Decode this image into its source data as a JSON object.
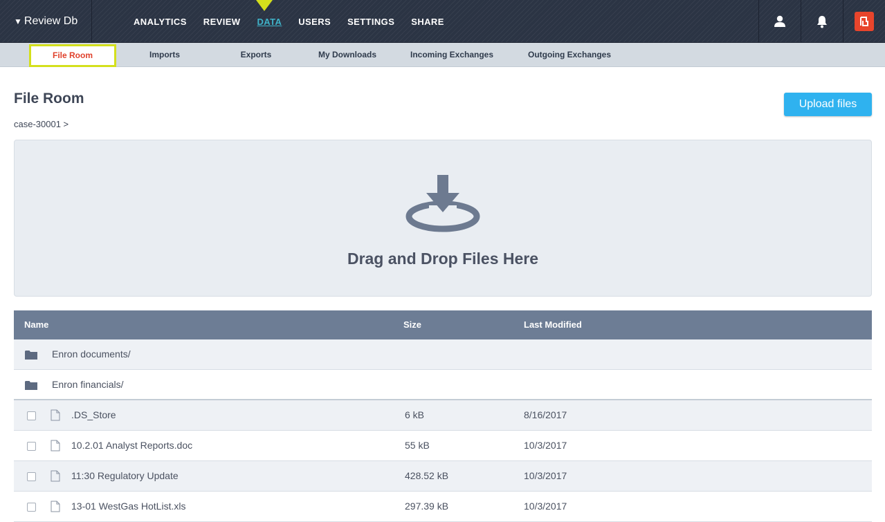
{
  "app": {
    "brand": "Review Db",
    "brand_caret": "▼"
  },
  "nav": {
    "items": [
      {
        "label": "ANALYTICS",
        "active": false
      },
      {
        "label": "REVIEW",
        "active": false
      },
      {
        "label": "DATA",
        "active": true
      },
      {
        "label": "USERS",
        "active": false
      },
      {
        "label": "SETTINGS",
        "active": false
      },
      {
        "label": "SHARE",
        "active": false
      }
    ],
    "icons": [
      "user-icon",
      "bell-icon",
      "brand-logo-icon"
    ]
  },
  "subnav": {
    "items": [
      {
        "label": "File Room",
        "active": true
      },
      {
        "label": "Imports",
        "active": false
      },
      {
        "label": "Exports",
        "active": false
      },
      {
        "label": "My Downloads",
        "active": false
      },
      {
        "label": "Incoming Exchanges",
        "active": false
      },
      {
        "label": "Outgoing Exchanges",
        "active": false
      }
    ]
  },
  "page": {
    "title": "File Room",
    "breadcrumb": "case-30001 >",
    "upload_label": "Upload files"
  },
  "dropzone": {
    "text": "Drag and Drop Files Here",
    "icon": "download-icon"
  },
  "table": {
    "headers": {
      "name": "Name",
      "size": "Size",
      "modified": "Last Modified"
    },
    "folders": [
      {
        "name": "Enron documents/"
      },
      {
        "name": "Enron financials/"
      }
    ],
    "files": [
      {
        "name": ".DS_Store",
        "size": "6 kB",
        "modified": "8/16/2017"
      },
      {
        "name": "10.2.01 Analyst Reports.doc",
        "size": "55 kB",
        "modified": "10/3/2017"
      },
      {
        "name": "11:30 Regulatory Update",
        "size": "428.52 kB",
        "modified": "10/3/2017"
      },
      {
        "name": "13-01 WestGas HotList.xls",
        "size": "297.39 kB",
        "modified": "10/3/2017"
      }
    ]
  },
  "colors": {
    "topbar": "#2b3444",
    "active_nav": "#3fb3c9",
    "highlight": "#d4e01c",
    "active_subnav_text": "#e0412b",
    "upload_button": "#2fb2ef",
    "table_header": "#6d7d95"
  }
}
